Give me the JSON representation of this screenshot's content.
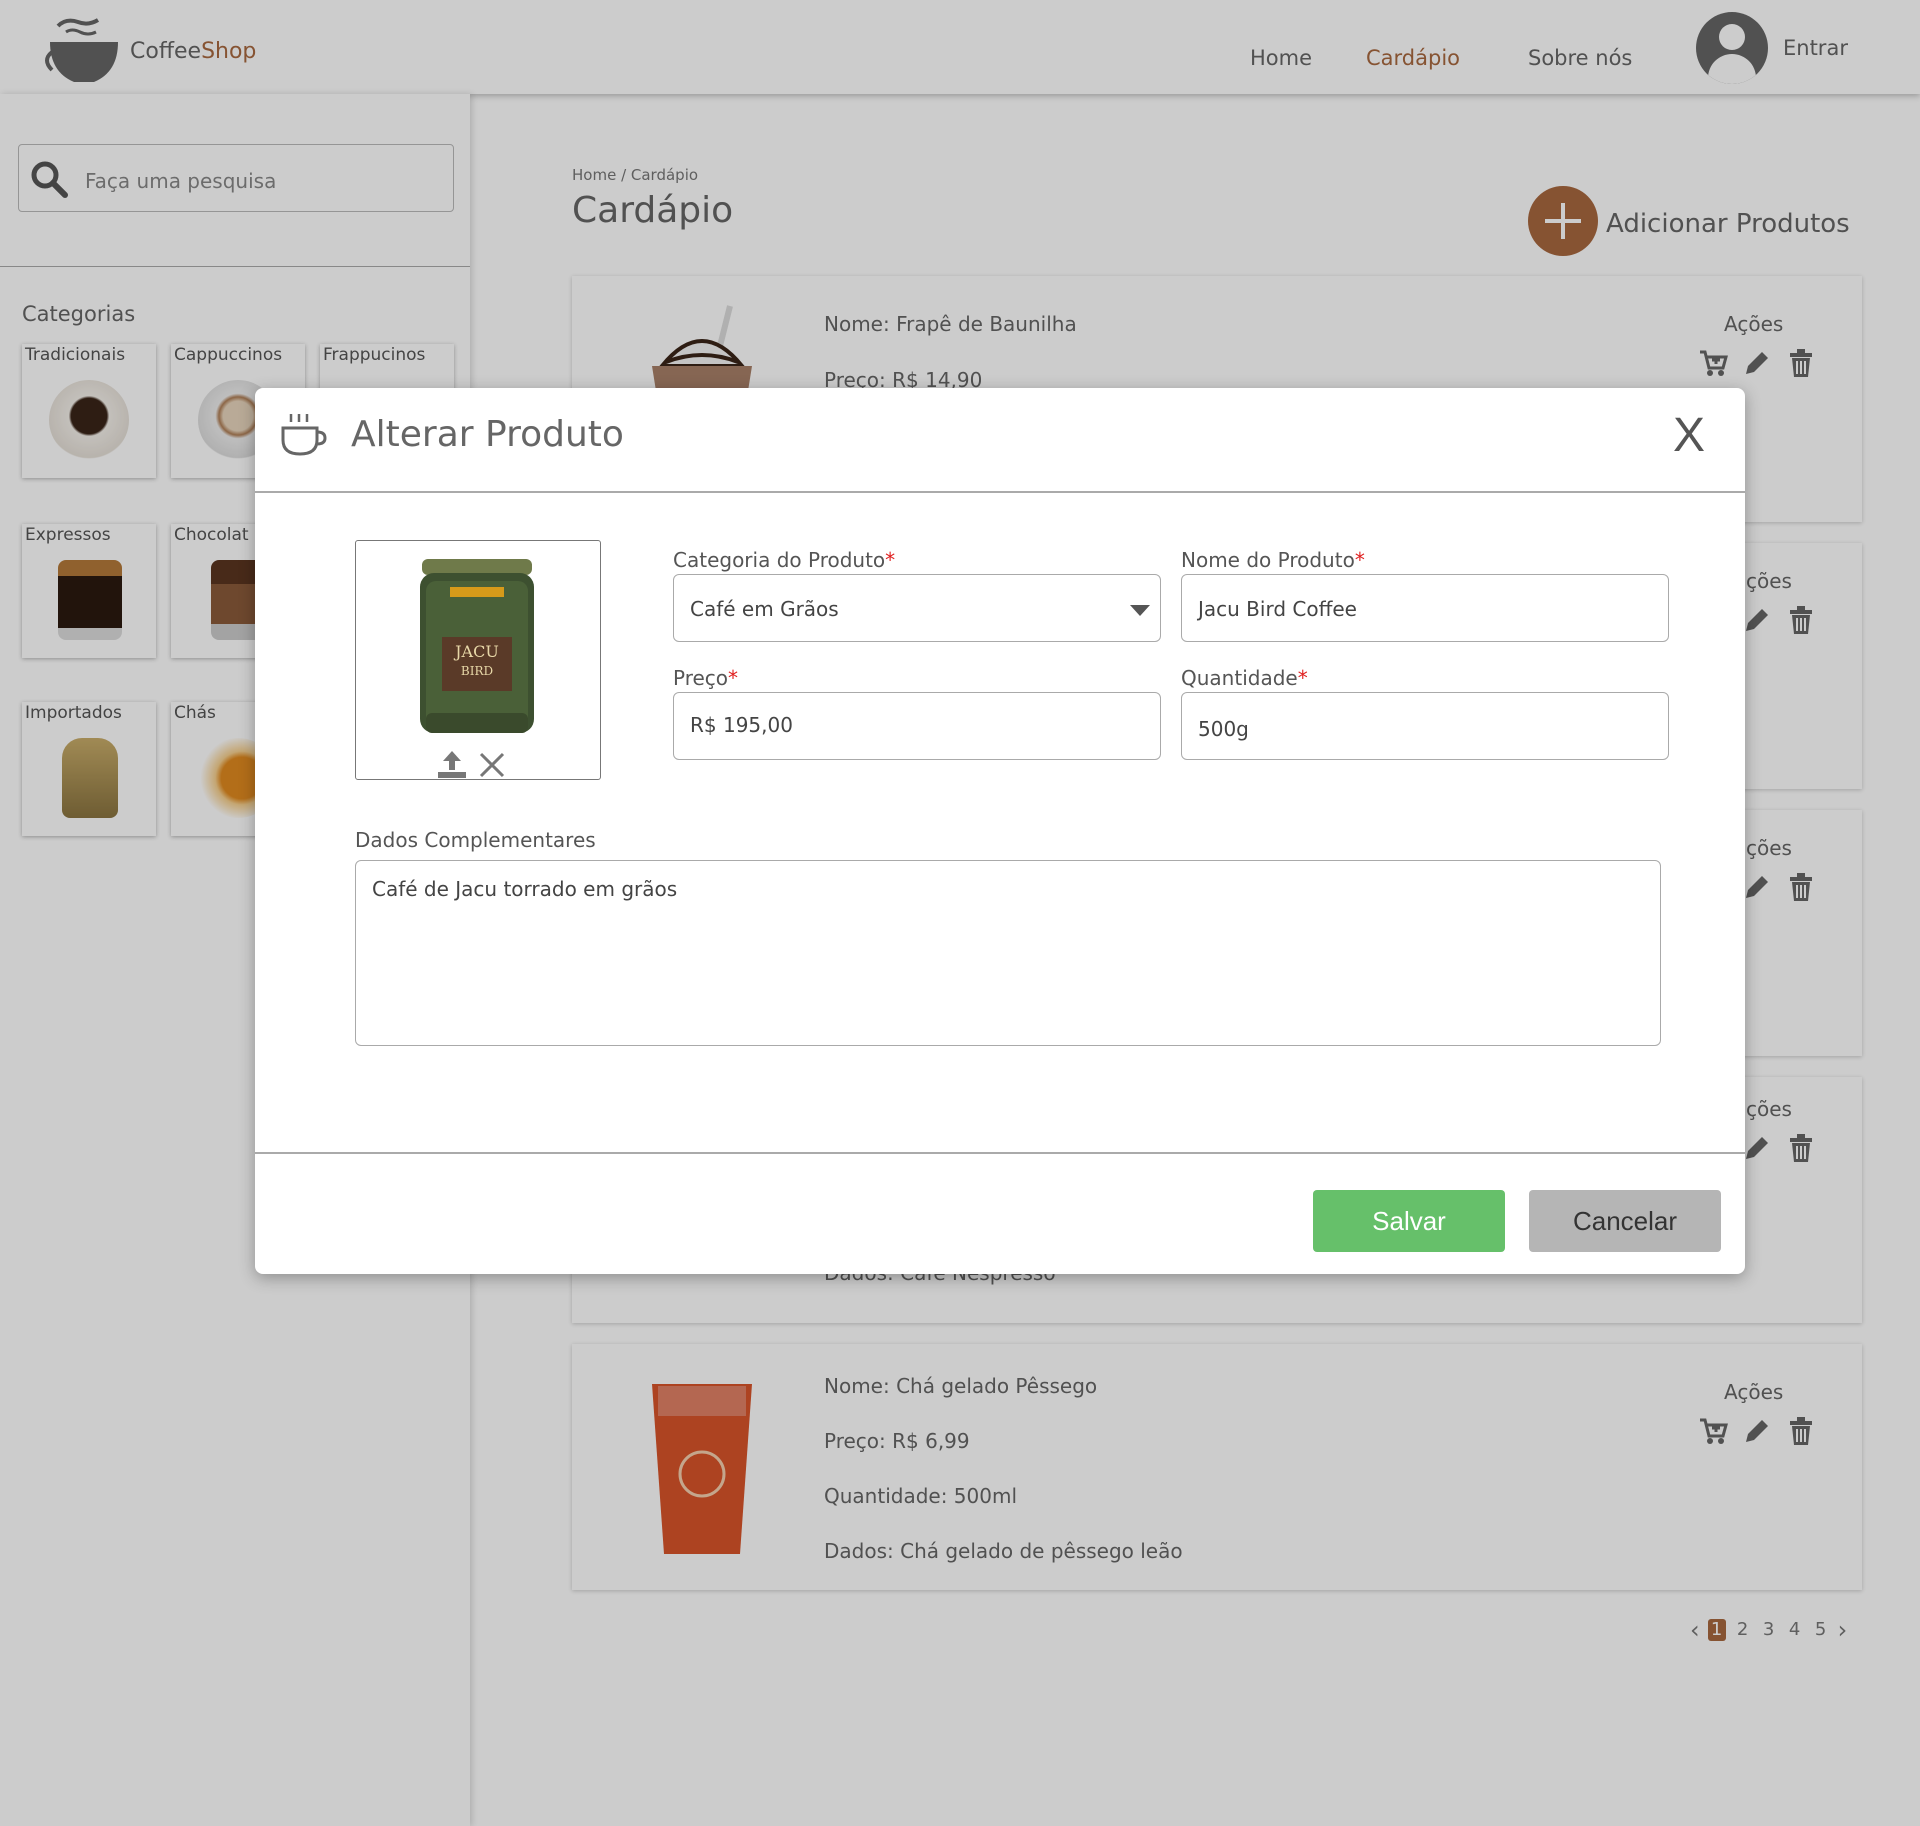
{
  "brand": {
    "name_part1": "Coffee",
    "name_part2": "Shop",
    "accent": "#a8683f"
  },
  "nav": {
    "home": "Home",
    "cardapio": "Cardápio",
    "sobre": "Sobre nós",
    "login": "Entrar"
  },
  "sidebar": {
    "search_placeholder": "Faça uma pesquisa",
    "categories_title": "Categorias",
    "categories": [
      "Tradicionais",
      "Cappuccinos",
      "Frappucinos",
      "Expressos",
      "Chocolat",
      "Importados",
      "Chás"
    ]
  },
  "main": {
    "breadcrumb": "Home / Cardápio",
    "title": "Cardápio",
    "add_label": "Adicionar Produtos",
    "actions_label": "Ações",
    "actions_label_partial": "ções",
    "products": [
      {
        "name": "Nome: Frapê de Baunilha",
        "price": "Preço: R$ 14,90"
      },
      {
        "data": "Dados: Café Nespresso"
      },
      {
        "name": "Nome: Chá gelado Pêssego",
        "price": "Preço: R$ 6,99",
        "qty": "Quantidade: 500ml",
        "data": "Dados: Chá gelado de pêssego leão"
      }
    ],
    "pagination": [
      "1",
      "2",
      "3",
      "4",
      "5"
    ],
    "current_page": "1"
  },
  "modal": {
    "title": "Alterar Produto",
    "close": "X",
    "category_label": "Categoria do Produto",
    "category_value": "Café em Grãos",
    "name_label": "Nome do Produto",
    "name_value": "Jacu Bird Coffee",
    "price_label": "Preço",
    "price_value": "R$ 195,00",
    "qty_label": "Quantidade",
    "qty_value": "500g",
    "extra_label": "Dados Complementares",
    "extra_value": "Café de Jacu torrado em grãos",
    "required_mark": "*",
    "save": "Salvar",
    "cancel": "Cancelar",
    "save_color": "#66c06a",
    "cancel_color": "#b5b5b5",
    "can_text": [
      "JACU",
      "BIRD"
    ]
  }
}
